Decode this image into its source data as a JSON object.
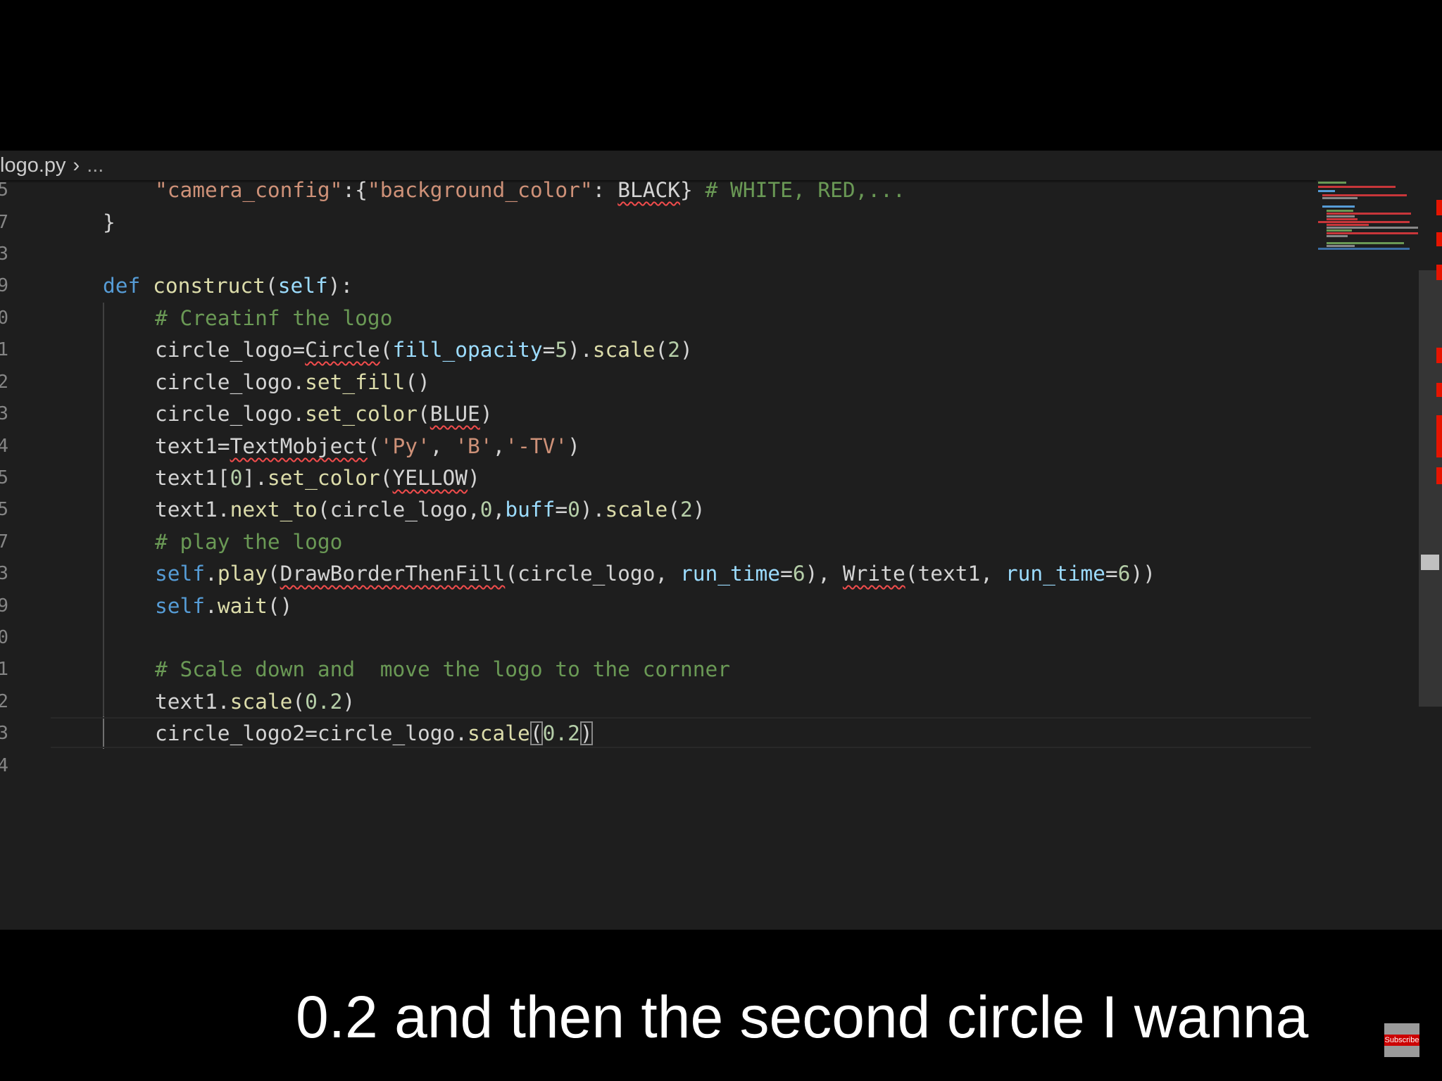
{
  "breadcrumb": {
    "file": "logo.py",
    "separator": "›",
    "tail": "..."
  },
  "line_numbers": [
    "5",
    "7",
    "3",
    "9",
    "0",
    "1",
    "2",
    "3",
    "4",
    "5",
    "5",
    "7",
    "3",
    "9",
    "0",
    "1",
    "2",
    "3",
    "4"
  ],
  "code": {
    "l6_s1": "\"camera_config\"",
    "l6_p1": ":{",
    "l6_s2": "\"background_color\"",
    "l6_p2": ": ",
    "l6_c1": "BLACK",
    "l6_p3": "} ",
    "l6_cm": "# WHITE, RED,...",
    "l7": "}",
    "l9_kw": "def",
    "l9_fn": "construct",
    "l9_p1": "(",
    "l9_self": "self",
    "l9_p2": "):",
    "l10_cm": "# Creatinf the logo",
    "l11_a": "circle_logo=",
    "l11_cls": "Circle",
    "l11_b": "(",
    "l11_kwarg": "fill_opacity",
    "l11_c": "=",
    "l11_n1": "5",
    "l11_d": ").",
    "l11_fn": "scale",
    "l11_e": "(",
    "l11_n2": "2",
    "l11_f": ")",
    "l12_a": "circle_logo.",
    "l12_fn": "set_fill",
    "l12_b": "()",
    "l13_a": "circle_logo.",
    "l13_fn": "set_color",
    "l13_b": "(",
    "l13_c": "BLUE",
    "l13_d": ")",
    "l14_a": "text1=",
    "l14_cls": "TextMobject",
    "l14_b": "(",
    "l14_s1": "'Py'",
    "l14_c": ", ",
    "l14_s2": "'B'",
    "l14_d": ",",
    "l14_s3": "'-TV'",
    "l14_e": ")",
    "l15_a": "text1[",
    "l15_n": "0",
    "l15_b": "].",
    "l15_fn": "set_color",
    "l15_c": "(",
    "l15_y": "YELLOW",
    "l15_d": ")",
    "l16_a": "text1.",
    "l16_fn": "next_to",
    "l16_b": "(circle_logo,",
    "l16_n1": "0",
    "l16_c": ",",
    "l16_kwarg": "buff",
    "l16_d": "=",
    "l16_n2": "0",
    "l16_e": ").",
    "l16_fn2": "scale",
    "l16_f": "(",
    "l16_n3": "2",
    "l16_g": ")",
    "l17_cm": "# play the logo",
    "l18_self": "self",
    "l18_a": ".",
    "l18_fn": "play",
    "l18_b": "(",
    "l18_cls": "DrawBorderThenFill",
    "l18_c": "(circle_logo, ",
    "l18_kw1": "run_time",
    "l18_d": "=",
    "l18_n1": "6",
    "l18_e": "), ",
    "l18_cls2": "Write",
    "l18_f": "(text1, ",
    "l18_kw2": "run_time",
    "l18_g": "=",
    "l18_n2": "6",
    "l18_h": "))",
    "l19_self": "self",
    "l19_a": ".",
    "l19_fn": "wait",
    "l19_b": "()",
    "l21_cm": "# Scale down and  move the logo to the cornner",
    "l22_a": "text1.",
    "l22_fn": "scale",
    "l22_b": "(",
    "l22_n": "0.2",
    "l22_c": ")",
    "l23_a": "circle_logo2=circle_logo.",
    "l23_fn": "scale",
    "l23_b": "(",
    "l23_n": "0.2",
    "l23_c": ")"
  },
  "caption": "0.2 and then the second circle I wanna",
  "subscribe_label": "Subscribe",
  "colors": {
    "background": "#1e1e1e",
    "keyword": "#569cd6",
    "function": "#dcdcaa",
    "string": "#ce9178",
    "comment": "#6a9955",
    "number": "#b5cea8",
    "parameter": "#9cdcfe",
    "error_squiggle": "#f14c4c"
  }
}
